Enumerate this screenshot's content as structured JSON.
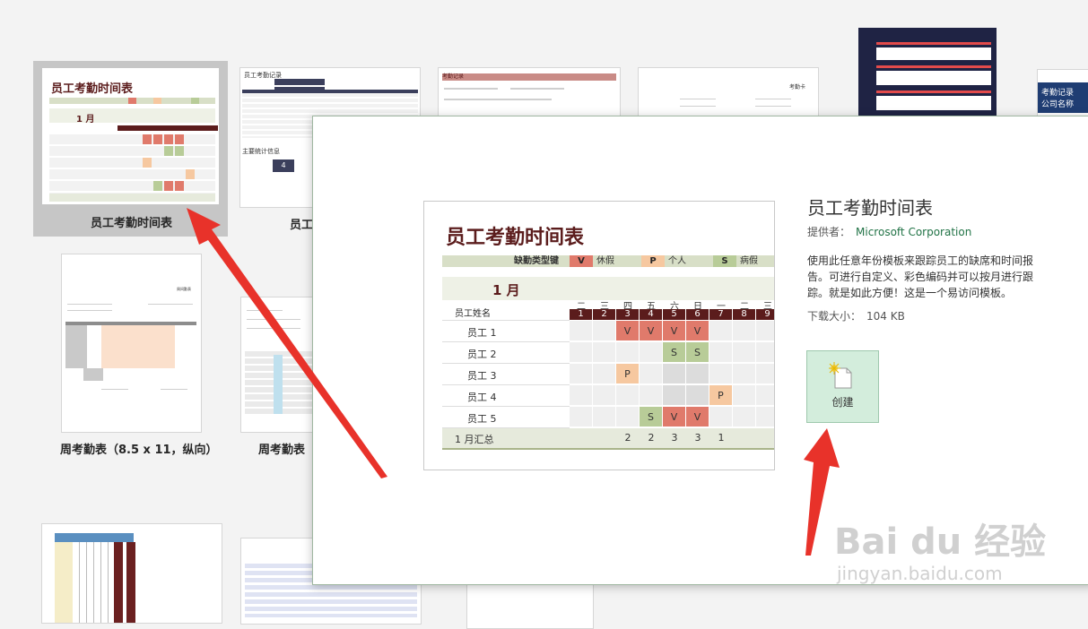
{
  "templates": [
    {
      "label": "员工考勤时间表",
      "selected": true
    },
    {
      "label": "员工",
      "selected": false
    },
    {
      "label": "周考勤表（8.5 x 11，纵向）",
      "selected": false
    },
    {
      "label": "周考勤表（",
      "selected": false
    }
  ],
  "thumbs": {
    "attendance_record_title": "员工考勤记录",
    "stats_heading": "主要统计信息",
    "stat_value": "4",
    "attendance_card_title": "考勤卡",
    "dark_card_title": "考勤记录",
    "dark_card_sub": "公司名称",
    "weekly_title": "周间勤表",
    "employee_record_title": "考勤记录"
  },
  "preview": {
    "title": "员工考勤时间表",
    "legend_label": "缺勤类型键",
    "legend": [
      {
        "key": "V",
        "text": "休假",
        "color": "#e07a6b"
      },
      {
        "key": "P",
        "text": "个人",
        "color": "#f6c8a0"
      },
      {
        "key": "S",
        "text": "病假",
        "color": "#b8cc98"
      }
    ],
    "month": "1 月",
    "name_header": "员工姓名",
    "weekdays": [
      "二",
      "三",
      "四",
      "五",
      "六",
      "日",
      "一",
      "二",
      "三"
    ],
    "days": [
      "1",
      "2",
      "3",
      "4",
      "5",
      "6",
      "7",
      "8",
      "9"
    ],
    "employees": [
      {
        "name": "员工 1",
        "cells": [
          "",
          "",
          "V",
          "V",
          "V",
          "V",
          "",
          "",
          ""
        ]
      },
      {
        "name": "员工 2",
        "cells": [
          "",
          "",
          "",
          "",
          "S",
          "S",
          "",
          "",
          ""
        ]
      },
      {
        "name": "员工 3",
        "cells": [
          "",
          "",
          "P",
          "",
          "",
          "",
          "",
          "",
          ""
        ]
      },
      {
        "name": "员工 4",
        "cells": [
          "",
          "",
          "",
          "",
          "",
          "",
          "P",
          "",
          ""
        ]
      },
      {
        "name": "员工 5",
        "cells": [
          "",
          "",
          "",
          "S",
          "V",
          "V",
          "",
          "",
          ""
        ]
      }
    ],
    "total_label": "1 月汇总",
    "totals": [
      "",
      "",
      "2",
      "2",
      "3",
      "3",
      "1",
      "",
      ""
    ]
  },
  "details": {
    "title": "员工考勤时间表",
    "provider_label": "提供者：",
    "provider_name": "Microsoft Corporation",
    "description": "使用此任意年份模板来跟踪员工的缺席和时间报告。可进行自定义、彩色编码并可以按月进行跟踪。就是如此方便！这是一个易访问模板。",
    "size_label": "下载大小：",
    "size_value": "104 KB",
    "create_label": "创建"
  },
  "colors": {
    "accent": "#217346",
    "arrow": "#e8322a",
    "brand": "#5b1c1c"
  },
  "watermark": {
    "brand": "Bai du 经验",
    "url": "jingyan.baidu.com"
  }
}
